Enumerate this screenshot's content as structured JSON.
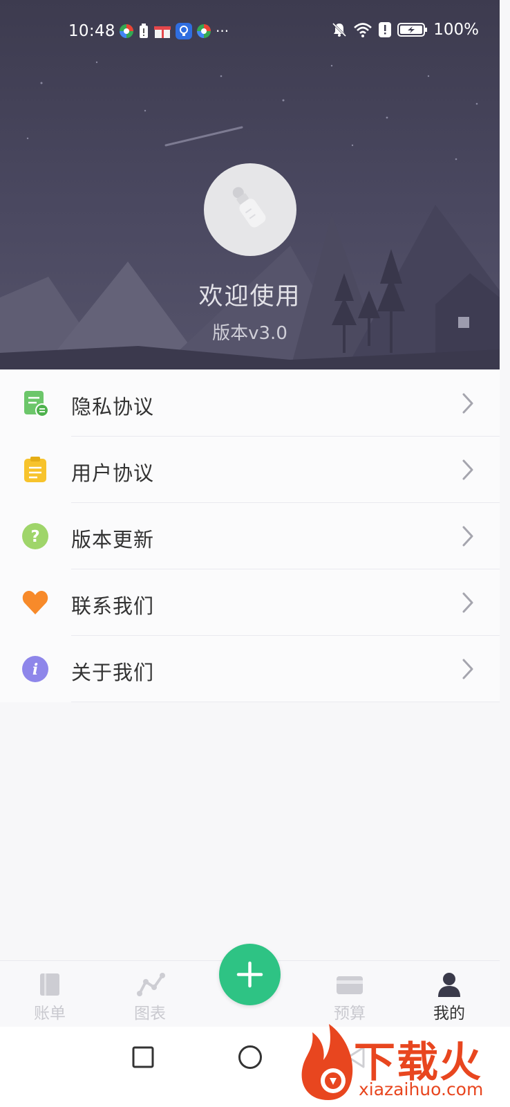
{
  "status_bar": {
    "time": "10:48",
    "more": "···",
    "battery_percent": "100%"
  },
  "profile": {
    "welcome": "欢迎使用",
    "version": "版本v3.0"
  },
  "menu": {
    "items": [
      {
        "label": "隐私协议",
        "icon": "privacy-doc-icon",
        "color": "#6cc66a"
      },
      {
        "label": "用户协议",
        "icon": "clipboard-icon",
        "color": "#f7c32c"
      },
      {
        "label": "版本更新",
        "icon": "question-icon",
        "color": "#9fd56a"
      },
      {
        "label": "联系我们",
        "icon": "heart-icon",
        "color": "#f78a2a"
      },
      {
        "label": "关于我们",
        "icon": "info-icon",
        "color": "#8e86ea"
      }
    ]
  },
  "tabbar": {
    "tabs": [
      {
        "label": "账单",
        "icon": "book-icon",
        "active": false
      },
      {
        "label": "图表",
        "icon": "chart-icon",
        "active": false
      },
      {
        "label": "预算",
        "icon": "card-icon",
        "active": false
      },
      {
        "label": "我的",
        "icon": "user-icon",
        "active": true
      }
    ],
    "add_icon": "plus-icon",
    "accent": "#2ec384"
  },
  "watermark": {
    "brand": "下载火",
    "domain": "xiazaihuo.com"
  }
}
